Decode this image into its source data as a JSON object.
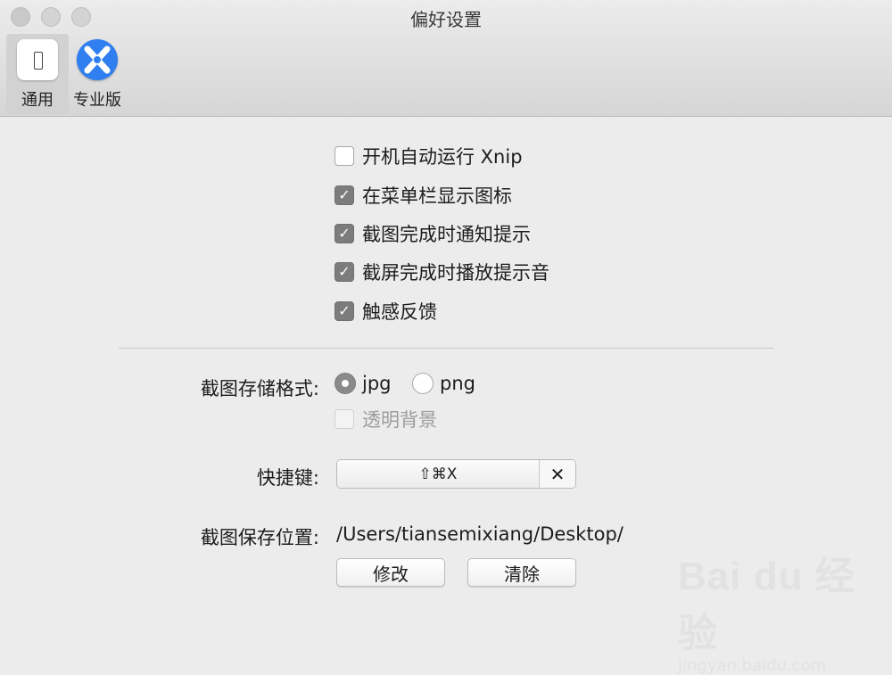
{
  "window": {
    "title": "偏好设置"
  },
  "toolbar": {
    "tabs": [
      {
        "label": "通用",
        "icon": "general-icon",
        "active": true
      },
      {
        "label": "专业版",
        "icon": "xnip-pro-icon",
        "active": false
      }
    ]
  },
  "options": [
    {
      "label": "开机自动运行 Xnip",
      "checked": false
    },
    {
      "label": "在菜单栏显示图标",
      "checked": true
    },
    {
      "label": "截图完成时通知提示",
      "checked": true
    },
    {
      "label": "截屏完成时播放提示音",
      "checked": true
    },
    {
      "label": "触感反馈",
      "checked": true
    }
  ],
  "format": {
    "label": "截图存储格式:",
    "choices": [
      {
        "label": "jpg",
        "selected": true
      },
      {
        "label": "png",
        "selected": false
      }
    ],
    "transparent_label": "透明背景",
    "transparent_enabled": false
  },
  "shortcut": {
    "label": "快捷键:",
    "keys": "⇧⌘X",
    "clear_symbol": "✕"
  },
  "save_location": {
    "label": "截图保存位置:",
    "path": "/Users/tiansemixiang/Desktop/",
    "modify_label": "修改",
    "clear_label": "清除"
  },
  "watermark": {
    "brand": "Bai du 经验",
    "url": "jingyan.baidu.com"
  },
  "colors": {
    "accent_pro_icon": "#2f7ff0",
    "checked_box": "#7c7c7c",
    "window_bg": "#ececec"
  }
}
